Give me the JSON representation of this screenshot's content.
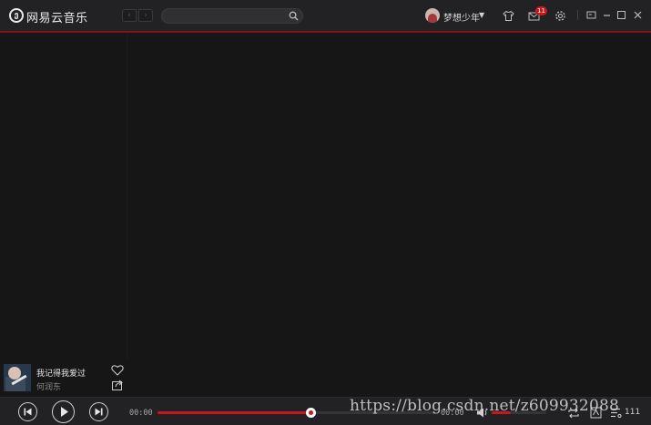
{
  "app": {
    "name": "网易云音乐",
    "logo_glyph": "ე"
  },
  "nav": {
    "back_glyph": "‹",
    "forward_glyph": "›"
  },
  "search": {
    "placeholder": "",
    "value": ""
  },
  "user": {
    "name": "梦想少年"
  },
  "toolbar": {
    "messages_badge": "11"
  },
  "now_playing": {
    "title": "我记得我爱过",
    "artist": "何润东"
  },
  "player": {
    "current_time": "00:00",
    "duration": "00:00",
    "progress_percent": 55,
    "volume_percent": 35,
    "playlist_count": "111"
  },
  "watermark": "https://blog.csdn.net/z609932088",
  "colors": {
    "accent": "#c9171e",
    "titlebar": "#222225",
    "background": "#161616"
  }
}
